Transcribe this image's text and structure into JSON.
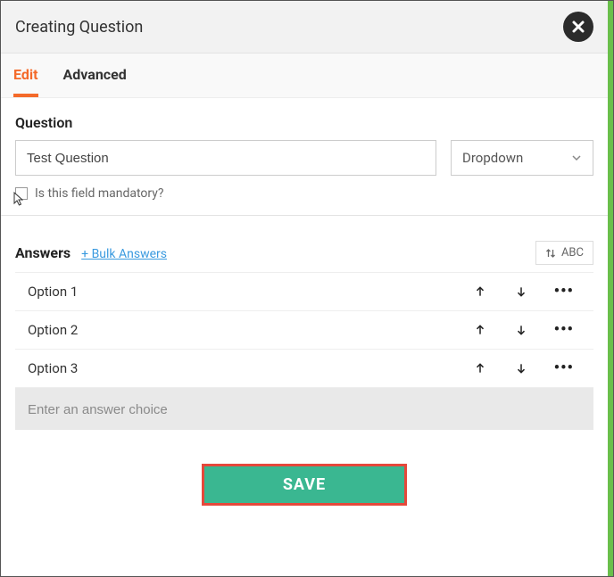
{
  "header": {
    "title": "Creating Question"
  },
  "tabs": {
    "edit": "Edit",
    "advanced": "Advanced"
  },
  "question": {
    "label": "Question",
    "value": "Test Question",
    "type_selected": "Dropdown",
    "mandatory_label": "Is this field mandatory?"
  },
  "answers": {
    "title": "Answers",
    "bulk_link": "+ Bulk Answers",
    "sort_label": "ABC",
    "options": [
      {
        "label": "Option 1"
      },
      {
        "label": "Option 2"
      },
      {
        "label": "Option 3"
      }
    ],
    "new_placeholder": "Enter an answer choice"
  },
  "footer": {
    "save": "SAVE"
  }
}
